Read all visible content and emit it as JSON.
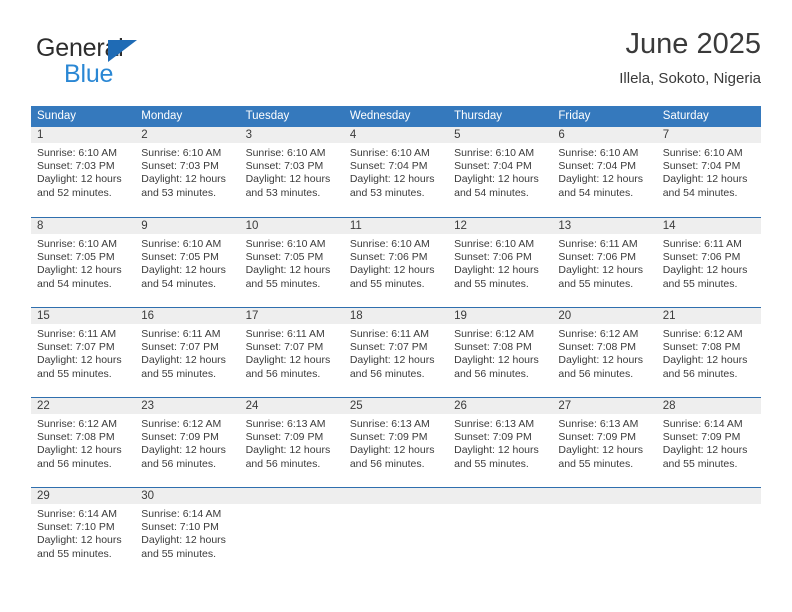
{
  "brand": {
    "name_top": "General",
    "name_bottom": "Blue",
    "triangle_color": "#1f6bb5",
    "text_color_top": "#2d2d2d",
    "text_color_bottom": "#2a87d4",
    "logo_icon": "triangle-flag-icon"
  },
  "header": {
    "title": "June 2025",
    "subtitle": "Illela, Sokoto, Nigeria"
  },
  "theme": {
    "header_row_bg": "#3579bd",
    "row_rule": "#2f6fae",
    "day_band_bg": "#eeeeee",
    "text": "#3b3b3b"
  },
  "calendar": {
    "weekday_headers": [
      "Sunday",
      "Monday",
      "Tuesday",
      "Wednesday",
      "Thursday",
      "Friday",
      "Saturday"
    ],
    "weeks": [
      [
        {
          "day": "1",
          "sunrise": "Sunrise: 6:10 AM",
          "sunset": "Sunset: 7:03 PM",
          "daylight_line1": "Daylight: 12 hours",
          "daylight_line2": "and 52 minutes."
        },
        {
          "day": "2",
          "sunrise": "Sunrise: 6:10 AM",
          "sunset": "Sunset: 7:03 PM",
          "daylight_line1": "Daylight: 12 hours",
          "daylight_line2": "and 53 minutes."
        },
        {
          "day": "3",
          "sunrise": "Sunrise: 6:10 AM",
          "sunset": "Sunset: 7:03 PM",
          "daylight_line1": "Daylight: 12 hours",
          "daylight_line2": "and 53 minutes."
        },
        {
          "day": "4",
          "sunrise": "Sunrise: 6:10 AM",
          "sunset": "Sunset: 7:04 PM",
          "daylight_line1": "Daylight: 12 hours",
          "daylight_line2": "and 53 minutes."
        },
        {
          "day": "5",
          "sunrise": "Sunrise: 6:10 AM",
          "sunset": "Sunset: 7:04 PM",
          "daylight_line1": "Daylight: 12 hours",
          "daylight_line2": "and 54 minutes."
        },
        {
          "day": "6",
          "sunrise": "Sunrise: 6:10 AM",
          "sunset": "Sunset: 7:04 PM",
          "daylight_line1": "Daylight: 12 hours",
          "daylight_line2": "and 54 minutes."
        },
        {
          "day": "7",
          "sunrise": "Sunrise: 6:10 AM",
          "sunset": "Sunset: 7:04 PM",
          "daylight_line1": "Daylight: 12 hours",
          "daylight_line2": "and 54 minutes."
        }
      ],
      [
        {
          "day": "8",
          "sunrise": "Sunrise: 6:10 AM",
          "sunset": "Sunset: 7:05 PM",
          "daylight_line1": "Daylight: 12 hours",
          "daylight_line2": "and 54 minutes."
        },
        {
          "day": "9",
          "sunrise": "Sunrise: 6:10 AM",
          "sunset": "Sunset: 7:05 PM",
          "daylight_line1": "Daylight: 12 hours",
          "daylight_line2": "and 54 minutes."
        },
        {
          "day": "10",
          "sunrise": "Sunrise: 6:10 AM",
          "sunset": "Sunset: 7:05 PM",
          "daylight_line1": "Daylight: 12 hours",
          "daylight_line2": "and 55 minutes."
        },
        {
          "day": "11",
          "sunrise": "Sunrise: 6:10 AM",
          "sunset": "Sunset: 7:06 PM",
          "daylight_line1": "Daylight: 12 hours",
          "daylight_line2": "and 55 minutes."
        },
        {
          "day": "12",
          "sunrise": "Sunrise: 6:10 AM",
          "sunset": "Sunset: 7:06 PM",
          "daylight_line1": "Daylight: 12 hours",
          "daylight_line2": "and 55 minutes."
        },
        {
          "day": "13",
          "sunrise": "Sunrise: 6:11 AM",
          "sunset": "Sunset: 7:06 PM",
          "daylight_line1": "Daylight: 12 hours",
          "daylight_line2": "and 55 minutes."
        },
        {
          "day": "14",
          "sunrise": "Sunrise: 6:11 AM",
          "sunset": "Sunset: 7:06 PM",
          "daylight_line1": "Daylight: 12 hours",
          "daylight_line2": "and 55 minutes."
        }
      ],
      [
        {
          "day": "15",
          "sunrise": "Sunrise: 6:11 AM",
          "sunset": "Sunset: 7:07 PM",
          "daylight_line1": "Daylight: 12 hours",
          "daylight_line2": "and 55 minutes."
        },
        {
          "day": "16",
          "sunrise": "Sunrise: 6:11 AM",
          "sunset": "Sunset: 7:07 PM",
          "daylight_line1": "Daylight: 12 hours",
          "daylight_line2": "and 55 minutes."
        },
        {
          "day": "17",
          "sunrise": "Sunrise: 6:11 AM",
          "sunset": "Sunset: 7:07 PM",
          "daylight_line1": "Daylight: 12 hours",
          "daylight_line2": "and 56 minutes."
        },
        {
          "day": "18",
          "sunrise": "Sunrise: 6:11 AM",
          "sunset": "Sunset: 7:07 PM",
          "daylight_line1": "Daylight: 12 hours",
          "daylight_line2": "and 56 minutes."
        },
        {
          "day": "19",
          "sunrise": "Sunrise: 6:12 AM",
          "sunset": "Sunset: 7:08 PM",
          "daylight_line1": "Daylight: 12 hours",
          "daylight_line2": "and 56 minutes."
        },
        {
          "day": "20",
          "sunrise": "Sunrise: 6:12 AM",
          "sunset": "Sunset: 7:08 PM",
          "daylight_line1": "Daylight: 12 hours",
          "daylight_line2": "and 56 minutes."
        },
        {
          "day": "21",
          "sunrise": "Sunrise: 6:12 AM",
          "sunset": "Sunset: 7:08 PM",
          "daylight_line1": "Daylight: 12 hours",
          "daylight_line2": "and 56 minutes."
        }
      ],
      [
        {
          "day": "22",
          "sunrise": "Sunrise: 6:12 AM",
          "sunset": "Sunset: 7:08 PM",
          "daylight_line1": "Daylight: 12 hours",
          "daylight_line2": "and 56 minutes."
        },
        {
          "day": "23",
          "sunrise": "Sunrise: 6:12 AM",
          "sunset": "Sunset: 7:09 PM",
          "daylight_line1": "Daylight: 12 hours",
          "daylight_line2": "and 56 minutes."
        },
        {
          "day": "24",
          "sunrise": "Sunrise: 6:13 AM",
          "sunset": "Sunset: 7:09 PM",
          "daylight_line1": "Daylight: 12 hours",
          "daylight_line2": "and 56 minutes."
        },
        {
          "day": "25",
          "sunrise": "Sunrise: 6:13 AM",
          "sunset": "Sunset: 7:09 PM",
          "daylight_line1": "Daylight: 12 hours",
          "daylight_line2": "and 56 minutes."
        },
        {
          "day": "26",
          "sunrise": "Sunrise: 6:13 AM",
          "sunset": "Sunset: 7:09 PM",
          "daylight_line1": "Daylight: 12 hours",
          "daylight_line2": "and 55 minutes."
        },
        {
          "day": "27",
          "sunrise": "Sunrise: 6:13 AM",
          "sunset": "Sunset: 7:09 PM",
          "daylight_line1": "Daylight: 12 hours",
          "daylight_line2": "and 55 minutes."
        },
        {
          "day": "28",
          "sunrise": "Sunrise: 6:14 AM",
          "sunset": "Sunset: 7:09 PM",
          "daylight_line1": "Daylight: 12 hours",
          "daylight_line2": "and 55 minutes."
        }
      ],
      [
        {
          "day": "29",
          "sunrise": "Sunrise: 6:14 AM",
          "sunset": "Sunset: 7:10 PM",
          "daylight_line1": "Daylight: 12 hours",
          "daylight_line2": "and 55 minutes."
        },
        {
          "day": "30",
          "sunrise": "Sunrise: 6:14 AM",
          "sunset": "Sunset: 7:10 PM",
          "daylight_line1": "Daylight: 12 hours",
          "daylight_line2": "and 55 minutes."
        },
        {
          "day": "",
          "sunrise": "",
          "sunset": "",
          "daylight_line1": "",
          "daylight_line2": ""
        },
        {
          "day": "",
          "sunrise": "",
          "sunset": "",
          "daylight_line1": "",
          "daylight_line2": ""
        },
        {
          "day": "",
          "sunrise": "",
          "sunset": "",
          "daylight_line1": "",
          "daylight_line2": ""
        },
        {
          "day": "",
          "sunrise": "",
          "sunset": "",
          "daylight_line1": "",
          "daylight_line2": ""
        },
        {
          "day": "",
          "sunrise": "",
          "sunset": "",
          "daylight_line1": "",
          "daylight_line2": ""
        }
      ]
    ]
  }
}
